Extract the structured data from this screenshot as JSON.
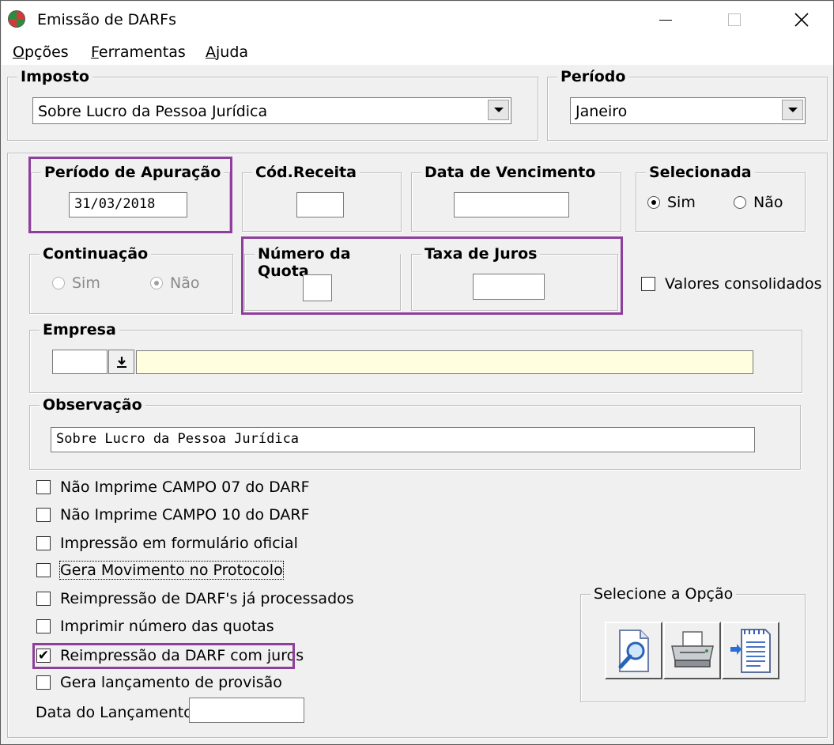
{
  "window": {
    "title": "Emissão de DARFs"
  },
  "menu": [
    {
      "label": "Opções",
      "accel": "O",
      "rest": "pções"
    },
    {
      "label": "Ferramentas",
      "accel": "F",
      "rest": "erramentas"
    },
    {
      "label": "Ajuda",
      "accel": "A",
      "rest": "juda"
    }
  ],
  "imposto": {
    "label": "Imposto",
    "value": "Sobre Lucro da Pessoa Jurídica"
  },
  "periodo": {
    "label": "Período",
    "value": "Janeiro"
  },
  "periodo_apuracao": {
    "label": "Período de Apuração",
    "value": "31/03/2018"
  },
  "cod_receita": {
    "label": "Cód.Receita",
    "value": ""
  },
  "data_vencimento": {
    "label": "Data de Vencimento",
    "value": ""
  },
  "selecionada": {
    "label": "Selecionada",
    "options": [
      "Sim",
      "Não"
    ],
    "selected": "Sim"
  },
  "continuacao": {
    "label": "Continuação",
    "options": [
      "Sim",
      "Não"
    ],
    "selected": "Não"
  },
  "numero_quota": {
    "label": "Número da Quota",
    "value": ""
  },
  "taxa_juros": {
    "label": "Taxa de Juros",
    "value": ""
  },
  "valores_consolidados": {
    "label": "Valores consolidados",
    "checked": false
  },
  "empresa": {
    "label": "Empresa",
    "code": "",
    "name": ""
  },
  "observacao": {
    "label": "Observação",
    "value": "Sobre Lucro da Pessoa Jurídica"
  },
  "checkboxes": [
    {
      "label": "Não Imprime CAMPO 07 do DARF",
      "checked": false
    },
    {
      "label": "Não Imprime CAMPO 10 do DARF",
      "checked": false
    },
    {
      "label": "Impressão em formulário oficial",
      "checked": false
    },
    {
      "label": "Gera Movimento no Protocolo",
      "checked": false
    },
    {
      "label": "Reimpressão de DARF's já processados",
      "checked": false
    },
    {
      "label": "Imprimir número das quotas",
      "checked": false
    },
    {
      "label": "Reimpressão da DARF com juros",
      "checked": true
    },
    {
      "label": "Gera lançamento de provisão",
      "checked": false
    }
  ],
  "data_lancamento": {
    "label": "Data do Lançamento:",
    "value": ""
  },
  "selecione_opcao": {
    "label": "Selecione a Opção",
    "buttons": [
      "preview-icon",
      "printer-icon",
      "export-document-icon"
    ]
  },
  "colors": {
    "highlight": "#8e3f9c",
    "empresa_bg": "#ffffe0"
  }
}
